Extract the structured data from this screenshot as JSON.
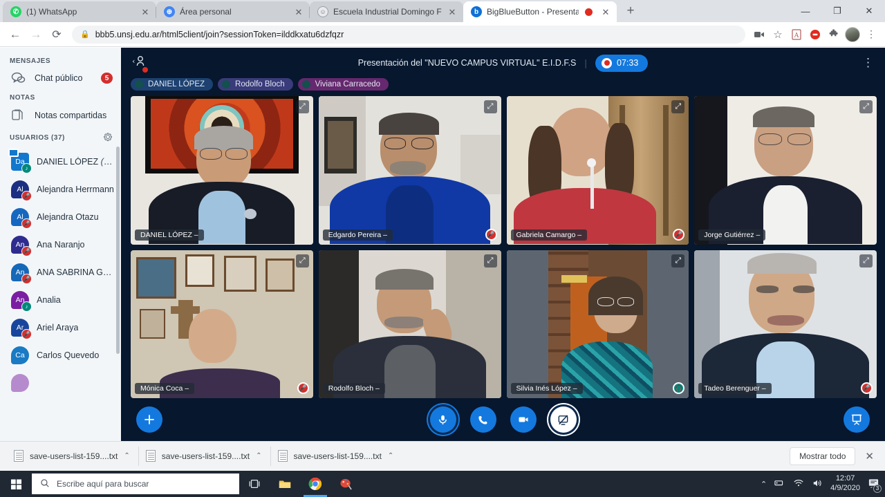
{
  "browser": {
    "tabs": [
      {
        "title": "(1) WhatsApp",
        "favicon": "whatsapp-icon",
        "active": false,
        "recording": false
      },
      {
        "title": "Área personal",
        "favicon": "globe-icon",
        "active": false,
        "recording": false
      },
      {
        "title": "Escuela Industrial Domingo Faust",
        "favicon": "school-icon",
        "active": false,
        "recording": false
      },
      {
        "title": "BigBlueButton - Presentació",
        "favicon": "bbb-icon",
        "active": true,
        "recording": true
      }
    ],
    "newtab_label": "+",
    "window_controls": {
      "minimize": "—",
      "maximize": "❐",
      "close": "✕"
    },
    "omnibox": {
      "url": "bbb5.unsj.edu.ar/html5client/join?sessionToken=ilddkxatu6dzfqzr",
      "lock_icon": "lock-icon"
    },
    "nav": {
      "back": "←",
      "forward": "→",
      "reload": "⟳"
    },
    "extensions": [
      "camera-icon",
      "bookmark-star-icon",
      "pdf-icon",
      "adblock-icon",
      "puzzle-icon",
      "profile-avatar",
      "chrome-menu-icon"
    ]
  },
  "sidebar": {
    "messages_heading": "MENSAJES",
    "public_chat": {
      "label": "Chat público",
      "icon": "chat-icon",
      "unread": "5"
    },
    "notes_heading": "NOTAS",
    "shared_notes": {
      "label": "Notas compartidas",
      "icon": "notes-icon"
    },
    "users_heading": "USUARIOS (37)",
    "settings_icon": "gear-icon",
    "users": [
      {
        "initials": "Da",
        "name": "DANIEL LÓPEZ",
        "you": "(Tu)",
        "color": "#1278cd",
        "status": "audio",
        "presenter": true
      },
      {
        "initials": "Al",
        "name": "Alejandra Herrmann",
        "you": "",
        "color": "#1b2f83",
        "status": "muted",
        "presenter": false
      },
      {
        "initials": "Al",
        "name": "Alejandra Otazu",
        "you": "",
        "color": "#1667c0",
        "status": "muted",
        "presenter": false
      },
      {
        "initials": "An",
        "name": "Ana Naranjo",
        "you": "",
        "color": "#2f2c8f",
        "status": "muted",
        "presenter": false
      },
      {
        "initials": "An",
        "name": "ANA SABRINA GON…",
        "you": "",
        "color": "#1668b8",
        "status": "muted",
        "presenter": false
      },
      {
        "initials": "An",
        "name": "Analia",
        "you": "",
        "color": "#7a1fa2",
        "status": "audio",
        "presenter": false
      },
      {
        "initials": "Ar",
        "name": "Ariel Araya",
        "you": "",
        "color": "#19469d",
        "status": "muted",
        "presenter": false
      },
      {
        "initials": "Ca",
        "name": "Carlos Quevedo",
        "you": "",
        "color": "#1a7ac4",
        "status": "none",
        "presenter": false
      }
    ]
  },
  "meeting": {
    "title": "Presentación del \"NUEVO CAMPUS VIRTUAL\" E.I.D.F.S",
    "recording_time": "07:33",
    "recording_icon": "record-icon",
    "participant_icon": "recording-person-icon",
    "options_icon": "kebab-menu-icon",
    "active_talkers": [
      {
        "name": "DANIEL LÓPEZ",
        "bg": "#1d4170"
      },
      {
        "name": "Rodolfo Bloch",
        "bg": "#3a3b7a"
      },
      {
        "name": "Viviana Carracedo",
        "bg": "#66286e"
      }
    ],
    "videos": [
      {
        "name": "Mónica Coca",
        "status": "muted",
        "active_speaker": false,
        "expand_icon": "expand-icon"
      },
      {
        "name": "DANIEL LÓPEZ",
        "status": "none",
        "active_speaker": false,
        "expand_icon": "expand-icon"
      },
      {
        "name": "Edgardo Pereira",
        "status": "muted",
        "active_speaker": false,
        "expand_icon": "expand-icon"
      },
      {
        "name": "Gabriela Camargo",
        "status": "muted",
        "active_speaker": true,
        "expand_icon": "expand-icon"
      },
      {
        "name": "Jorge Gutiérrez",
        "status": "none",
        "active_speaker": false,
        "expand_icon": "expand-icon"
      },
      {
        "name": "Rodolfo Bloch",
        "status": "none",
        "active_speaker": false,
        "expand_icon": "expand-icon"
      },
      {
        "name": "Silvia Inés López",
        "status": "audio",
        "active_speaker": true,
        "expand_icon": "expand-icon"
      },
      {
        "name": "Tadeo Berenguer",
        "status": "muted",
        "active_speaker": false,
        "expand_icon": "expand-icon"
      }
    ],
    "actions": {
      "add_icon": "plus-icon",
      "mic_icon": "microphone-icon",
      "leave_audio_icon": "phone-icon",
      "camera_icon": "video-camera-icon",
      "screenshare_icon": "screen-share-off-icon",
      "presentation_icon": "presentation-icon"
    }
  },
  "downloads": {
    "items": [
      {
        "filename": "save-users-list-159....txt",
        "caret": "⌃",
        "icon": "text-file-icon"
      },
      {
        "filename": "save-users-list-159....txt",
        "caret": "⌃",
        "icon": "text-file-icon"
      },
      {
        "filename": "save-users-list-159....txt",
        "caret": "⌃",
        "icon": "text-file-icon"
      }
    ],
    "show_all_label": "Mostrar todo",
    "close_label": "✕"
  },
  "taskbar": {
    "start_icon": "windows-start-icon",
    "search_placeholder": "Escribe aquí para buscar",
    "search_icon": "search-icon",
    "apps": [
      {
        "name": "task-view-icon",
        "active": false
      },
      {
        "name": "file-explorer-icon",
        "active": false
      },
      {
        "name": "chrome-icon",
        "active": true
      },
      {
        "name": "paint-icon",
        "active": false
      }
    ],
    "tray": {
      "chevron": "⌃",
      "icons": [
        "hardware-icon",
        "wifi-icon",
        "volume-icon"
      ],
      "time": "12:07",
      "date": "4/9/2020",
      "notification_icon": "notifications-icon",
      "notification_count": "3"
    }
  },
  "colors": {
    "accent_blue": "#1479df",
    "bbb_background": "#06172e",
    "sidebar_background": "#f3f6f9",
    "badge_red": "#d32f2f",
    "audio_teal": "#00897b",
    "taskbar": "#1f2833"
  }
}
